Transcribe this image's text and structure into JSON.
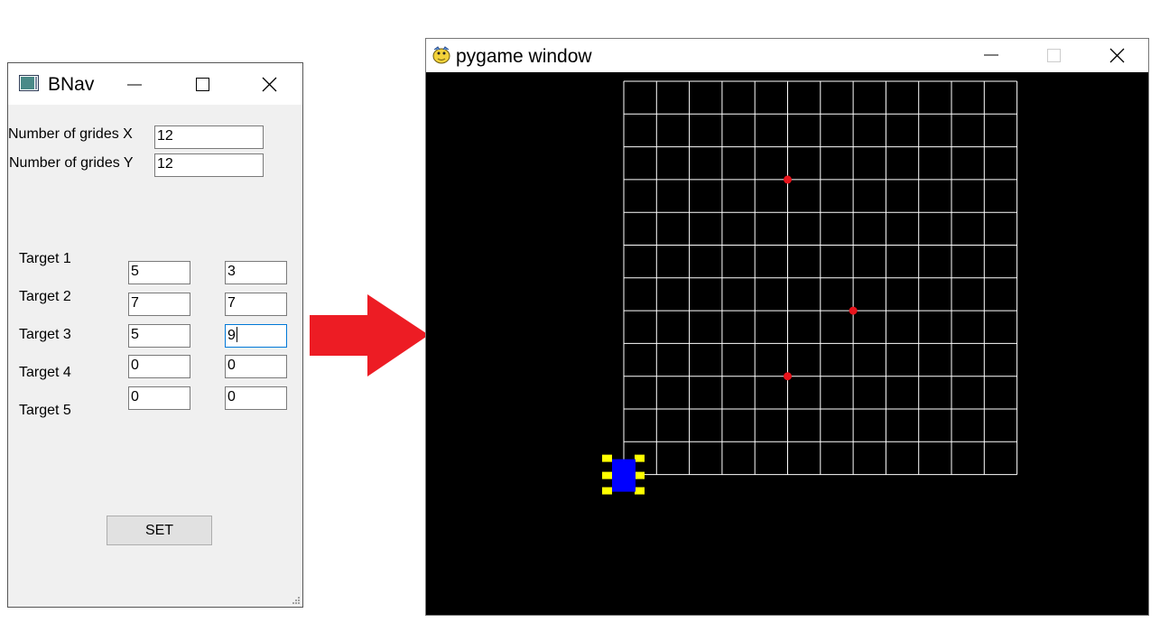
{
  "bnav": {
    "title": "BNav",
    "grid_x_label": "Number of grides X",
    "grid_x_value": "12",
    "grid_y_label": "Number of grides Y",
    "grid_y_value": "12",
    "targets": [
      {
        "label": "Target 1",
        "x": "5",
        "y": "3"
      },
      {
        "label": "Target 2",
        "x": "7",
        "y": "7"
      },
      {
        "label": "Target 3",
        "x": "5",
        "y": "9"
      },
      {
        "label": "Target 4",
        "x": "0",
        "y": "0"
      },
      {
        "label": "Target 5",
        "x": "0",
        "y": "0"
      }
    ],
    "set_label": "SET"
  },
  "pygame": {
    "title": "pygame window",
    "grid_cols": 12,
    "grid_rows": 12,
    "target_cells": [
      [
        5,
        3
      ],
      [
        7,
        7
      ],
      [
        5,
        9
      ]
    ],
    "robot_cell": [
      0,
      12
    ],
    "colors": {
      "background": "#000000",
      "grid_line": "#ffffff",
      "target": "#e8141c",
      "robot_body": "#0000ff",
      "robot_wheels": "#ffff00",
      "arrow": "#ed1c24"
    }
  }
}
